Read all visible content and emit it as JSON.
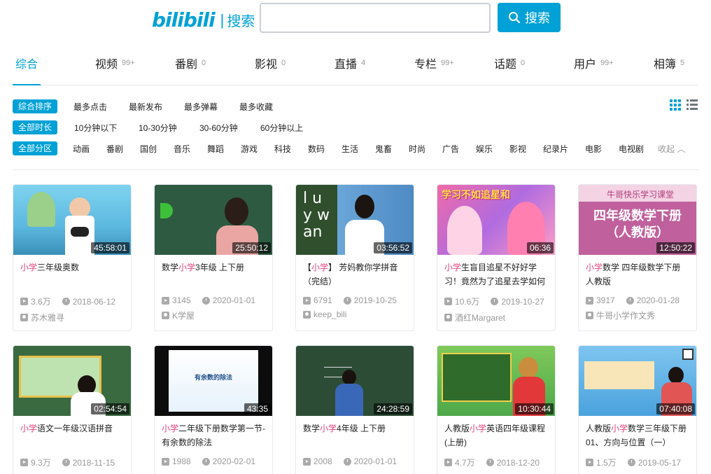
{
  "header": {
    "logo": "bilibili",
    "logo_sub": "搜索",
    "search_placeholder": "",
    "search_button": "搜索"
  },
  "tabs": [
    {
      "label": "综合",
      "count": ""
    },
    {
      "label": "视频",
      "count": "99+"
    },
    {
      "label": "番剧",
      "count": "0"
    },
    {
      "label": "影视",
      "count": "0"
    },
    {
      "label": "直播",
      "count": "4"
    },
    {
      "label": "专栏",
      "count": "99+"
    },
    {
      "label": "话题",
      "count": "0"
    },
    {
      "label": "用户",
      "count": "99+"
    },
    {
      "label": "相簿",
      "count": "5"
    }
  ],
  "filters": {
    "sort": {
      "selected": "综合排序",
      "options": [
        "最多点击",
        "最新发布",
        "最多弹幕",
        "最多收藏"
      ]
    },
    "duration": {
      "selected": "全部时长",
      "options": [
        "10分钟以下",
        "10-30分钟",
        "30-60分钟",
        "60分钟以上"
      ]
    },
    "zone": {
      "selected": "全部分区",
      "options": [
        "动画",
        "番剧",
        "国创",
        "音乐",
        "舞蹈",
        "游戏",
        "科技",
        "数码",
        "生活",
        "鬼畜",
        "时尚",
        "广告",
        "娱乐",
        "影视",
        "纪录片",
        "电影",
        "电视剧"
      ],
      "collapse": "收起"
    }
  },
  "videos": [
    {
      "dur": "45:58:01",
      "pre": "",
      "kw": "小学",
      "post": "三年级奥数",
      "views": "3.6万",
      "date": "2018-06-12",
      "up": "苏木雅寻"
    },
    {
      "dur": "25:50:12",
      "pre": "数学",
      "kw": "小学",
      "post": "3年级 上下册",
      "views": "3145",
      "date": "2020-01-01",
      "up": "K学屋"
    },
    {
      "dur": "03:56:52",
      "pre": "【",
      "kw": "小学",
      "post": "】 芳妈教你学拼音（完结）",
      "views": "6791",
      "date": "2019-10-25",
      "up": "keep_bili"
    },
    {
      "dur": "06:36",
      "pre": "",
      "kw": "小学",
      "post": "生盲目追星不好好学习！竟然为了追星去学如何",
      "views": "10.6万",
      "date": "2019-10-27",
      "up": "酒红Margaret"
    },
    {
      "dur": "12:50:22",
      "pre": "",
      "kw": "小学",
      "post": "数学 四年级数学下册 人教版",
      "views": "3917",
      "date": "2020-01-28",
      "up": "牛哥小学作文秀"
    },
    {
      "dur": "02:54:54",
      "pre": "",
      "kw": "小学",
      "post": "语文一年级汉语拼音",
      "views": "9.3万",
      "date": "2018-11-15",
      "up": ""
    },
    {
      "dur": "43:35",
      "pre": "",
      "kw": "小学",
      "post": "二年级下册数学第一节-有余数的除法",
      "views": "1988",
      "date": "2020-02-01",
      "up": ""
    },
    {
      "dur": "24:28:59",
      "pre": "数学",
      "kw": "小学",
      "post": "4年级 上下册",
      "views": "2008",
      "date": "2020-01-01",
      "up": ""
    },
    {
      "dur": "10:30:44",
      "pre": "人教版",
      "kw": "小学",
      "post": "英语四年级课程 (上册)",
      "views": "4.7万",
      "date": "2018-12-20",
      "up": ""
    },
    {
      "dur": "07:40:08",
      "pre": "人教版",
      "kw": "小学",
      "post": "数学三年级下册 01、方向与位置（一）",
      "views": "1.5万",
      "date": "2019-05-17",
      "up": ""
    }
  ],
  "thumbs": {
    "t4_text": "四年级数学下册（人教版）",
    "t4_banner": "牛哥快乐学习课堂",
    "t3_banner": "学习不如追星和",
    "t7_text": "有余数的除法"
  }
}
